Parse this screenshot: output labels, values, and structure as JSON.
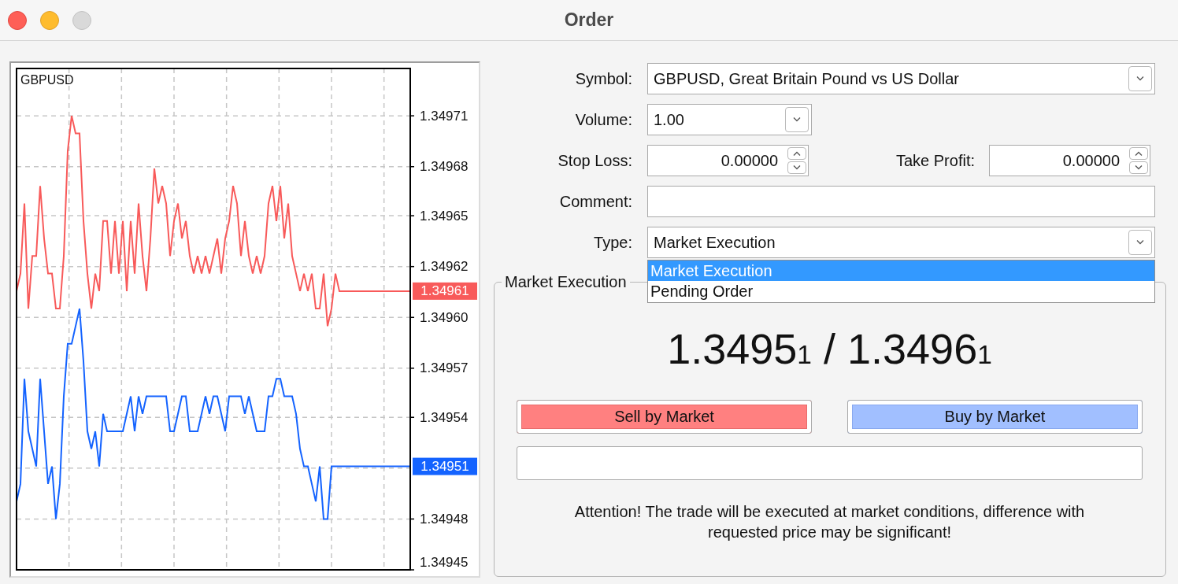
{
  "window": {
    "title": "Order",
    "buttons": [
      {
        "kind": "close",
        "disabled": false
      },
      {
        "kind": "minimize",
        "disabled": false
      },
      {
        "kind": "zoom",
        "disabled": true
      }
    ]
  },
  "chart": {
    "chart_data": {
      "type": "line",
      "title": "GBPUSD",
      "grid": true,
      "ylim": [
        1.349451,
        1.349737
      ],
      "yticks": [
        {
          "value": 1.34971,
          "label": "1.34971"
        },
        {
          "value": 1.349681,
          "label": "1.34968"
        },
        {
          "value": 1.349653,
          "label": "1.34965"
        },
        {
          "value": 1.349624,
          "label": "1.34962"
        },
        {
          "value": 1.349595,
          "label": "1.34960"
        },
        {
          "value": 1.349566,
          "label": "1.34957"
        },
        {
          "value": 1.349538,
          "label": "1.34954"
        },
        {
          "value": 1.34948,
          "label": "1.34948"
        },
        {
          "value": 1.349451,
          "label": "1.34945"
        }
      ],
      "series": [
        {
          "color": "#f85a5a",
          "values": [
            1.34961,
            1.34962,
            1.34966,
            1.3496,
            1.34963,
            1.34963,
            1.34967,
            1.34964,
            1.34962,
            1.34962,
            1.3496,
            1.3496,
            1.34963,
            1.34969,
            1.34971,
            1.3497,
            1.3497,
            1.34965,
            1.34962,
            1.3496,
            1.34962,
            1.34961,
            1.34965,
            1.34965,
            1.34962,
            1.34965,
            1.34962,
            1.34965,
            1.34961,
            1.34965,
            1.34962,
            1.34966,
            1.34963,
            1.34961,
            1.34964,
            1.34968,
            1.34966,
            1.34967,
            1.34966,
            1.34963,
            1.34965,
            1.34966,
            1.34964,
            1.34965,
            1.34963,
            1.34962,
            1.34963,
            1.34962,
            1.34963,
            1.34962,
            1.34963,
            1.34964,
            1.34962,
            1.34964,
            1.34965,
            1.34967,
            1.34966,
            1.34963,
            1.34965,
            1.34963,
            1.34962,
            1.34963,
            1.34962,
            1.34963,
            1.34966,
            1.34967,
            1.34965,
            1.34967,
            1.34964,
            1.34966,
            1.34963,
            1.34962,
            1.34961,
            1.34962,
            1.34961,
            1.34962,
            1.3496,
            1.3496,
            1.34962,
            1.34959,
            1.3496,
            1.34962,
            1.34961,
            1.34961,
            1.34961,
            1.34961,
            1.34961,
            1.34961,
            1.34961,
            1.34961,
            1.34961,
            1.34961,
            1.34961,
            1.34961,
            1.34961,
            1.34961,
            1.34961,
            1.34961,
            1.34961,
            1.34961,
            1.34961
          ]
        },
        {
          "color": "#1463ff",
          "values": [
            1.34949,
            1.3495,
            1.34956,
            1.34953,
            1.34952,
            1.34951,
            1.34956,
            1.34953,
            1.3495,
            1.34951,
            1.34948,
            1.3495,
            1.34955,
            1.34958,
            1.34958,
            1.34959,
            1.3496,
            1.34957,
            1.34953,
            1.34952,
            1.34953,
            1.34951,
            1.34954,
            1.34953,
            1.34953,
            1.34953,
            1.34953,
            1.34953,
            1.34954,
            1.34955,
            1.34953,
            1.34955,
            1.34954,
            1.34955,
            1.34955,
            1.34955,
            1.34955,
            1.34955,
            1.34955,
            1.34953,
            1.34953,
            1.34954,
            1.34955,
            1.34955,
            1.34953,
            1.34953,
            1.34953,
            1.34954,
            1.34955,
            1.34954,
            1.34955,
            1.34955,
            1.34954,
            1.34953,
            1.34955,
            1.34955,
            1.34955,
            1.34955,
            1.34954,
            1.34955,
            1.34954,
            1.34953,
            1.34953,
            1.34953,
            1.34955,
            1.34955,
            1.34956,
            1.34956,
            1.34955,
            1.34955,
            1.34955,
            1.34954,
            1.34952,
            1.34951,
            1.34951,
            1.3495,
            1.34949,
            1.34951,
            1.34948,
            1.34948,
            1.34951,
            1.34951,
            1.34951,
            1.34951,
            1.34951,
            1.34951,
            1.34951,
            1.34951,
            1.34951,
            1.34951,
            1.34951,
            1.34951,
            1.34951,
            1.34951,
            1.34951,
            1.34951,
            1.34951,
            1.34951,
            1.34951,
            1.34951,
            1.34951
          ]
        }
      ],
      "annotations": [
        "1.34961",
        "1.34951"
      ]
    }
  },
  "form": {
    "symbol": {
      "label": "Symbol:",
      "value": "GBPUSD, Great Britain Pound vs US Dollar"
    },
    "volume": {
      "label": "Volume:",
      "value": "1.00"
    },
    "stop_loss": {
      "label": "Stop Loss:",
      "value": "0.00000"
    },
    "take_profit": {
      "label": "Take Profit:",
      "value": "0.00000"
    },
    "comment": {
      "label": "Comment:"
    },
    "type": {
      "label": "Type:",
      "value": "Market Execution",
      "expanded": true,
      "options": [
        {
          "label": "Market Execution",
          "selected": true
        },
        {
          "label": "Pending Order",
          "selected": false
        }
      ]
    }
  },
  "execution": {
    "title": "Market Execution",
    "quote": "1.3495$_{1}$ / 1.3496$_{1}$",
    "buttons": [
      {
        "kind": "sell",
        "label": "Sell by Market"
      },
      {
        "kind": "buy",
        "label": "Buy by Market"
      }
    ],
    "notice": "Attention! The trade will be executed at market conditions, difference with requested price may be significant!"
  }
}
